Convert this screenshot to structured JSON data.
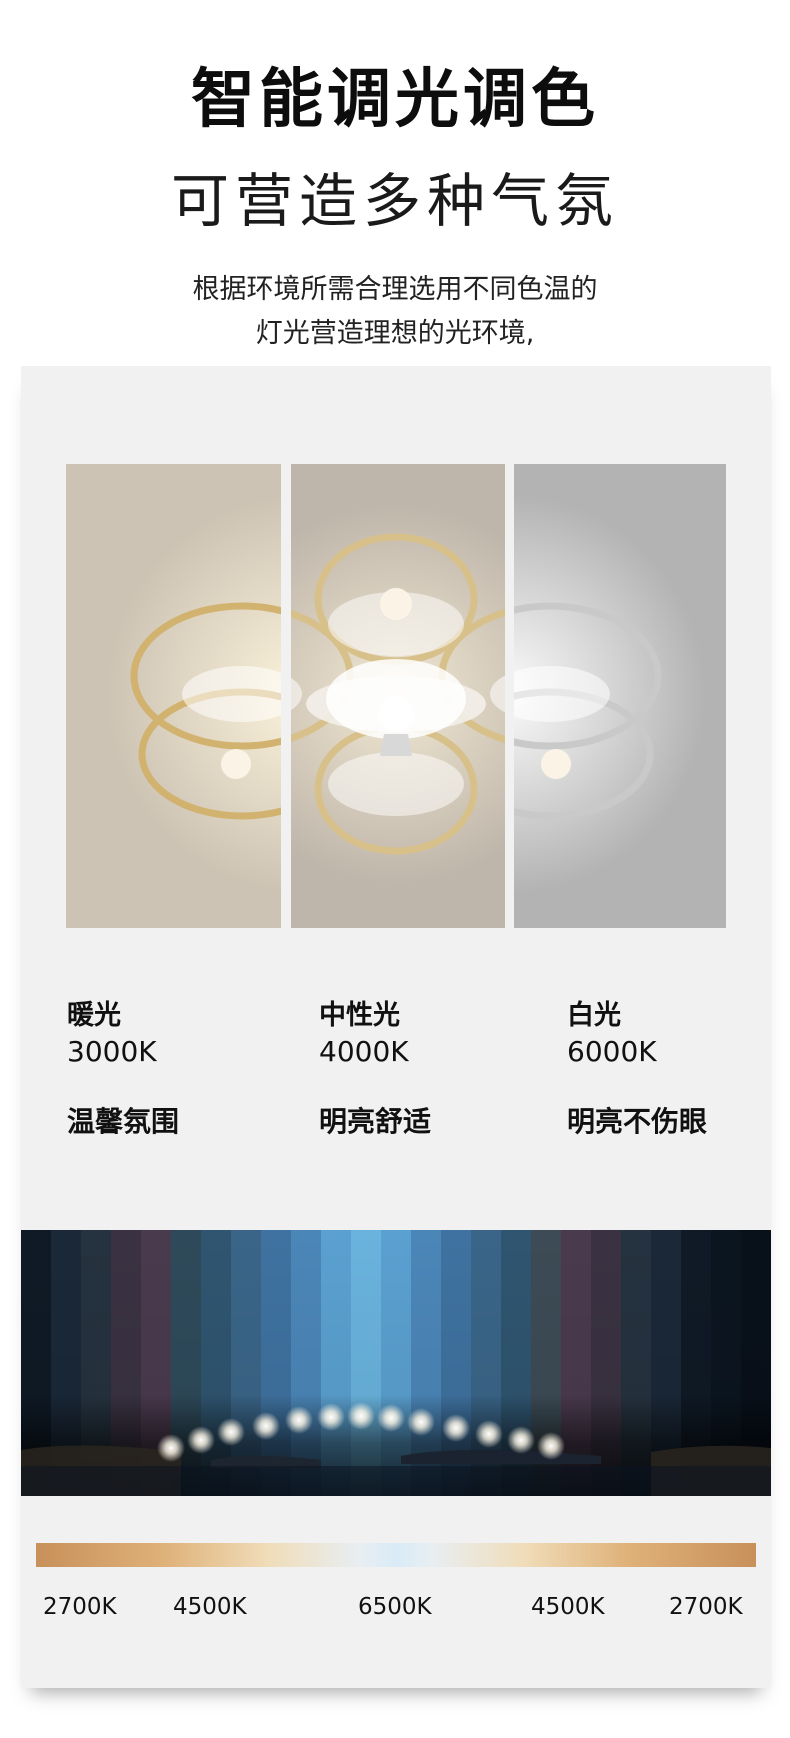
{
  "header": {
    "title": "智能调光调色",
    "subtitle": "可营造多种气氛",
    "description_line1": "根据环境所需合理选用不同色温的",
    "description_line2": "灯光营造理想的光环境,"
  },
  "panels": [
    {
      "mode": "warm",
      "color": "#cdc3b4"
    },
    {
      "mode": "neutral",
      "color": "#bfb6ab"
    },
    {
      "mode": "white",
      "color": "#b3b3b3"
    }
  ],
  "color_temps": [
    {
      "name": "暖光",
      "kelvin": "3000K",
      "mood": "温馨氛围"
    },
    {
      "name": "中性光",
      "kelvin": "4000K",
      "mood": "明亮舒适"
    },
    {
      "name": "白光",
      "kelvin": "6000K",
      "mood": "明亮不伤眼"
    }
  ],
  "scale_labels": [
    "2700K",
    "4500K",
    "6500K",
    "4500K",
    "2700K"
  ],
  "colors": {
    "card_bg": "#f1f1f1",
    "gold_ring": "#d2b26f",
    "silver_ring": "#c9c9c9",
    "warm_end": "#c8905a",
    "cool_center": "#d9ebf7"
  }
}
